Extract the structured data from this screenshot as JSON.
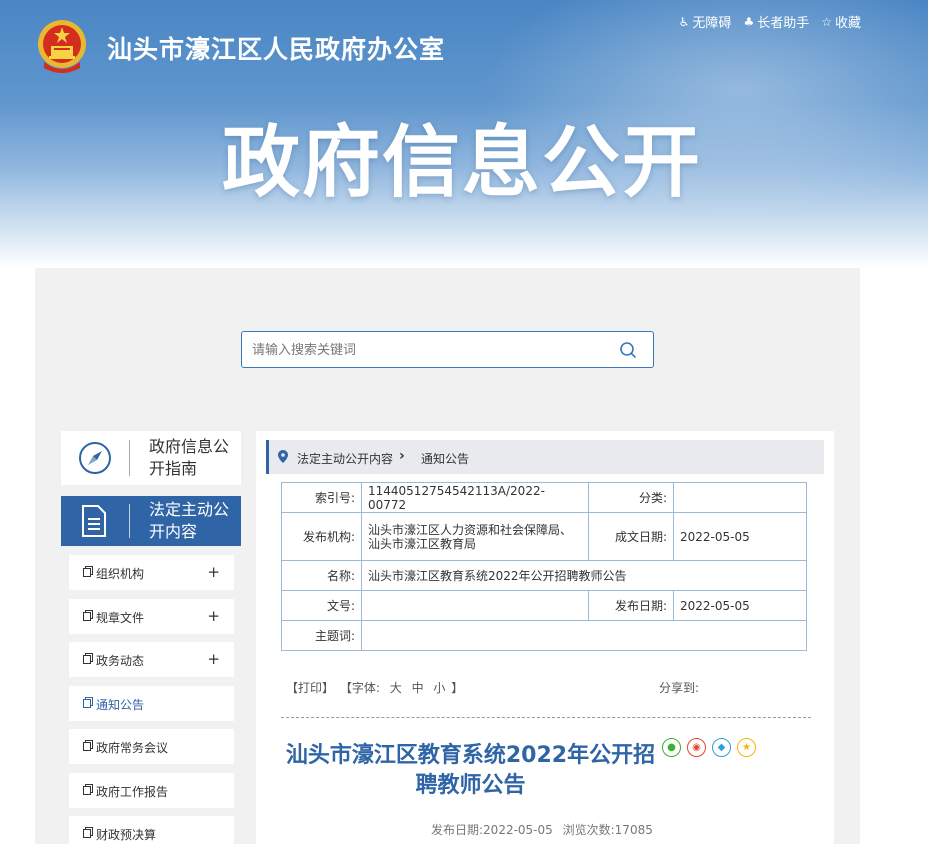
{
  "header": {
    "site_title": "汕头市濠江区人民政府办公室",
    "banner_title": "政府信息公开",
    "links": [
      {
        "icon": "accessibility-icon",
        "label": "无障碍"
      },
      {
        "icon": "elder-helper-icon",
        "label": "长者助手"
      },
      {
        "icon": "star-icon",
        "label": "收藏"
      }
    ]
  },
  "search": {
    "placeholder": "请输入搜索关键词"
  },
  "sidebar": {
    "guide_label": "政府信息公开指南",
    "content_label": "法定主动公开内容",
    "items": [
      {
        "label": "组织机构",
        "expandable": true
      },
      {
        "label": "规章文件",
        "expandable": true
      },
      {
        "label": "政务动态",
        "expandable": true
      },
      {
        "label": "通知公告",
        "expandable": false,
        "active": true
      },
      {
        "label": "政府常务会议",
        "expandable": false
      },
      {
        "label": "政府工作报告",
        "expandable": false
      },
      {
        "label": "财政预决算",
        "expandable": false
      }
    ],
    "plus_symbol": "+"
  },
  "breadcrumb": {
    "items": [
      "法定主动公开内容",
      "通知公告"
    ],
    "separator": "›"
  },
  "meta": {
    "index_label": "索引号:",
    "index_value": "11440512754542113A/2022-00772",
    "category_label": "分类:",
    "category_value": "",
    "publisher_label": "发布机构:",
    "publisher_value": "汕头市濠江区人力资源和社会保障局、汕头市濠江区教育局",
    "created_label": "成文日期:",
    "created_value": "2022-05-05",
    "name_label": "名称:",
    "name_value": "汕头市濠江区教育系统2022年公开招聘教师公告",
    "docno_label": "文号:",
    "docno_value": "",
    "published_label": "发布日期:",
    "published_value": "2022-05-05",
    "keywords_label": "主题词:",
    "keywords_value": ""
  },
  "tools": {
    "print": "【打印】",
    "font_prefix": "【字体:",
    "font_large": "大",
    "font_medium": "中",
    "font_small": "小",
    "font_suffix": "】",
    "share_label": "分享到:"
  },
  "share_icons": [
    {
      "name": "wechat-share-icon",
      "color": "#3cb034",
      "glyph": "●"
    },
    {
      "name": "weibo-share-icon",
      "color": "#e6462e",
      "glyph": "◉"
    },
    {
      "name": "qq-share-icon",
      "color": "#2d9fd9",
      "glyph": "◆"
    },
    {
      "name": "qzone-share-icon",
      "color": "#f5b400",
      "glyph": "★"
    }
  ],
  "article": {
    "title": "汕头市濠江区教育系统2022年公开招聘教师公告",
    "publish_label": "发布日期:",
    "publish_date": "2022-05-05",
    "views_label": "浏览次数:",
    "views": "17085"
  },
  "colors": {
    "accent": "#2f65a7",
    "banner": "#4a86c4",
    "border": "#9cb9d6"
  }
}
